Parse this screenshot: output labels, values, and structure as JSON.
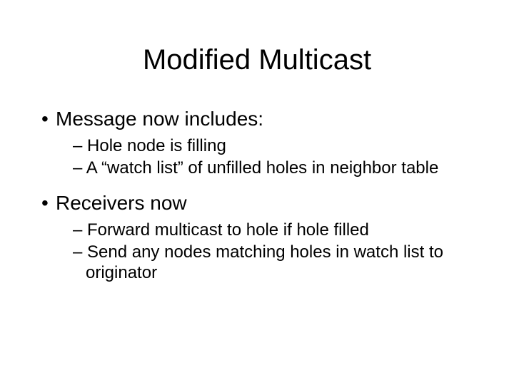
{
  "title": "Modified Multicast",
  "bullets": [
    {
      "text": "Message now includes:",
      "sub": [
        "Hole node is filling",
        "A “watch list” of unfilled holes in neighbor table"
      ]
    },
    {
      "text": "Receivers now",
      "sub": [
        "Forward multicast to hole if hole filled",
        "Send any nodes matching holes in watch list to originator"
      ]
    }
  ]
}
